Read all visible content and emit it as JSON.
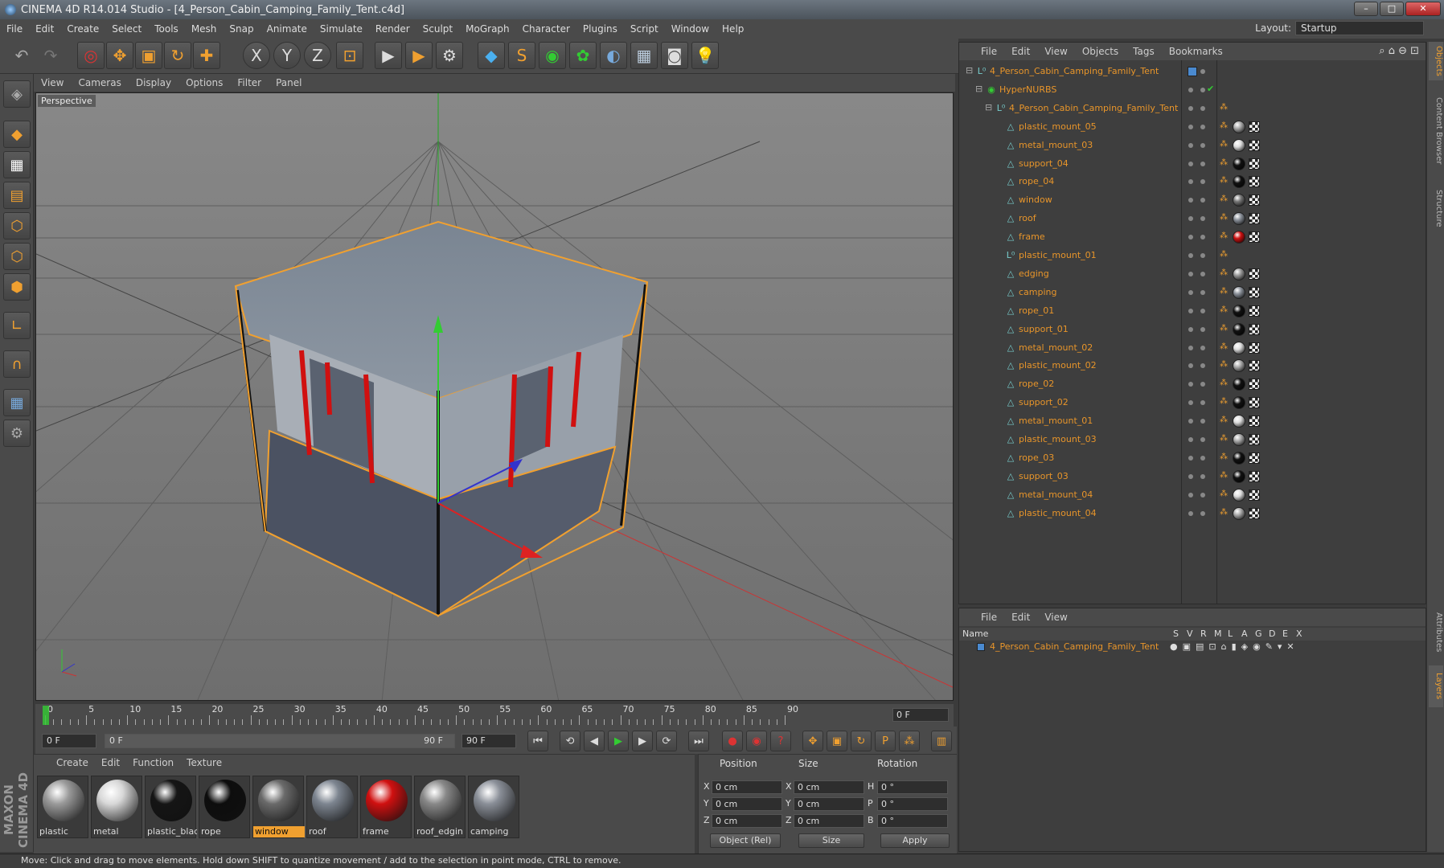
{
  "window": {
    "title": "CINEMA 4D R14.014 Studio - [4_Person_Cabin_Camping_Family_Tent.c4d]",
    "minimize": "–",
    "maximize": "□",
    "close": "✕"
  },
  "menu": [
    "File",
    "Edit",
    "Create",
    "Select",
    "Tools",
    "Mesh",
    "Snap",
    "Animate",
    "Simulate",
    "Render",
    "Sculpt",
    "MoGraph",
    "Character",
    "Plugins",
    "Script",
    "Window",
    "Help"
  ],
  "layout": {
    "label": "Layout:",
    "value": "Startup"
  },
  "toolbar_icons": {
    "undo": "↶",
    "redo": "↷",
    "select": "◎",
    "move": "✥",
    "scale": "▣",
    "rotate": "↻",
    "add": "✚",
    "x": "X",
    "y": "Y",
    "z": "Z",
    "coord": "⊡",
    "render_view": "▶",
    "render_pic": "▶",
    "render_settings": "⚙",
    "cube": "◆",
    "spline": "S",
    "nurbs": "◉",
    "array": "✿",
    "deformer": "◐",
    "scene": "▦",
    "camera": "◙",
    "light": "💡"
  },
  "viewport": {
    "menu": [
      "View",
      "Cameras",
      "Display",
      "Options",
      "Filter",
      "Panel"
    ],
    "label": "Perspective"
  },
  "timeline": {
    "ticks": [
      "0",
      "5",
      "10",
      "15",
      "20",
      "25",
      "30",
      "35",
      "40",
      "45",
      "50",
      "55",
      "60",
      "65",
      "70",
      "75",
      "80",
      "85",
      "90"
    ],
    "current_frame": "0 F"
  },
  "playbar": {
    "start": "0 F",
    "range_start": "0 F",
    "range_end": "90 F",
    "end": "90 F"
  },
  "materials": {
    "menu": [
      "Create",
      "Edit",
      "Function",
      "Texture"
    ],
    "items": [
      {
        "name": "plastic",
        "color": "#9a9a9a",
        "selected": false
      },
      {
        "name": "metal",
        "color": "#d8d8d8",
        "selected": false
      },
      {
        "name": "plastic_blac",
        "color": "#151515",
        "selected": false
      },
      {
        "name": "rope",
        "color": "#0d0d0d",
        "selected": false
      },
      {
        "name": "window",
        "color": "#6a6a6a",
        "selected": true
      },
      {
        "name": "roof",
        "color": "#7d8590",
        "selected": false
      },
      {
        "name": "frame",
        "color": "#d01010",
        "selected": false
      },
      {
        "name": "roof_edgin",
        "color": "#888888",
        "selected": false
      },
      {
        "name": "camping",
        "color": "#8a8f98",
        "selected": false
      }
    ]
  },
  "coordinates": {
    "headers": [
      "Position",
      "Size",
      "Rotation"
    ],
    "rows": [
      {
        "axis": "X",
        "pos": "0 cm",
        "size_axis": "X",
        "size": "0 cm",
        "rot_axis": "H",
        "rot": "0 °"
      },
      {
        "axis": "Y",
        "pos": "0 cm",
        "size_axis": "Y",
        "size": "0 cm",
        "rot_axis": "P",
        "rot": "0 °"
      },
      {
        "axis": "Z",
        "pos": "0 cm",
        "size_axis": "Z",
        "size": "0 cm",
        "rot_axis": "B",
        "rot": "0 °"
      }
    ],
    "mode": "Object (Rel)",
    "size_mode": "Size",
    "apply": "Apply"
  },
  "objects": {
    "menu": [
      "File",
      "Edit",
      "View",
      "Objects",
      "Tags",
      "Bookmarks"
    ],
    "rows": [
      {
        "name": "4_Person_Cabin_Camping_Family_Tent",
        "indent": 0,
        "icon": "L⁰"
      },
      {
        "name": "HyperNURBS",
        "indent": 1,
        "icon": "◉"
      },
      {
        "name": "4_Person_Cabin_Camping_Family_Tent",
        "indent": 2,
        "icon": "L⁰"
      },
      {
        "name": "plastic_mount_05",
        "indent": 3,
        "icon": "△",
        "mat": "#aaaaaa"
      },
      {
        "name": "metal_mount_03",
        "indent": 3,
        "icon": "△",
        "mat": "#dddddd"
      },
      {
        "name": "support_04",
        "indent": 3,
        "icon": "△",
        "mat": "#111111"
      },
      {
        "name": "rope_04",
        "indent": 3,
        "icon": "△",
        "mat": "#111111"
      },
      {
        "name": "window",
        "indent": 3,
        "icon": "△",
        "mat": "#777777"
      },
      {
        "name": "roof",
        "indent": 3,
        "icon": "△",
        "mat": "#8a9099"
      },
      {
        "name": "frame",
        "indent": 3,
        "icon": "△",
        "mat": "#cc1111"
      },
      {
        "name": "plastic_mount_01",
        "indent": 3,
        "icon": "L⁰"
      },
      {
        "name": "edging",
        "indent": 3,
        "icon": "△",
        "mat": "#999999"
      },
      {
        "name": "camping",
        "indent": 3,
        "icon": "△",
        "mat": "#8a9099"
      },
      {
        "name": "rope_01",
        "indent": 3,
        "icon": "△",
        "mat": "#111111"
      },
      {
        "name": "support_01",
        "indent": 3,
        "icon": "△",
        "mat": "#111111"
      },
      {
        "name": "metal_mount_02",
        "indent": 3,
        "icon": "△",
        "mat": "#dddddd"
      },
      {
        "name": "plastic_mount_02",
        "indent": 3,
        "icon": "△",
        "mat": "#aaaaaa"
      },
      {
        "name": "rope_02",
        "indent": 3,
        "icon": "△",
        "mat": "#111111"
      },
      {
        "name": "support_02",
        "indent": 3,
        "icon": "△",
        "mat": "#111111"
      },
      {
        "name": "metal_mount_01",
        "indent": 3,
        "icon": "△",
        "mat": "#dddddd"
      },
      {
        "name": "plastic_mount_03",
        "indent": 3,
        "icon": "△",
        "mat": "#aaaaaa"
      },
      {
        "name": "rope_03",
        "indent": 3,
        "icon": "△",
        "mat": "#111111"
      },
      {
        "name": "support_03",
        "indent": 3,
        "icon": "△",
        "mat": "#111111"
      },
      {
        "name": "metal_mount_04",
        "indent": 3,
        "icon": "△",
        "mat": "#dddddd"
      },
      {
        "name": "plastic_mount_04",
        "indent": 3,
        "icon": "△",
        "mat": "#aaaaaa"
      }
    ]
  },
  "layers": {
    "menu": [
      "File",
      "Edit",
      "View"
    ],
    "columns": [
      "Name",
      "S",
      "V",
      "R",
      "M",
      "L",
      "A",
      "G",
      "D",
      "E",
      "X"
    ],
    "rows": [
      {
        "name": "4_Person_Cabin_Camping_Family_Tent"
      }
    ]
  },
  "right_tabs": [
    "Objects",
    "Content Browser",
    "Structure",
    "Attributes",
    "Layers"
  ],
  "brand": "MAXON CINEMA 4D",
  "status": "Move: Click and drag to move elements. Hold down SHIFT to quantize movement / add to the selection in point mode, CTRL to remove.",
  "colors": {
    "accent": "#f0a030",
    "selection": "#e8952a",
    "frame_red": "#d01010"
  }
}
